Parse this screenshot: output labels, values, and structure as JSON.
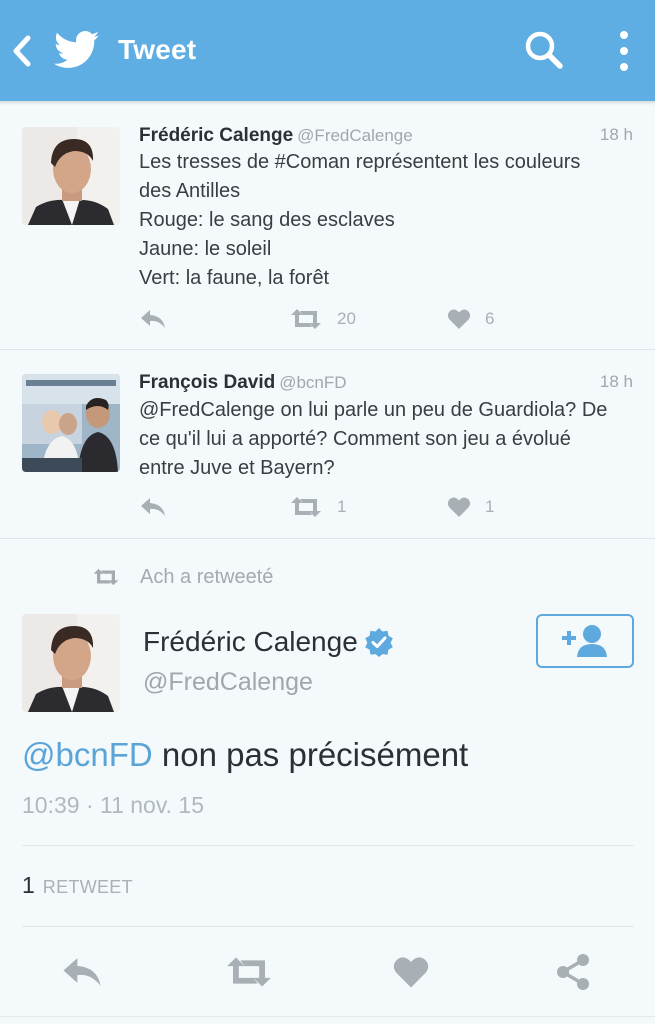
{
  "app_bar": {
    "title": "Tweet",
    "background": "#5eade3",
    "icons": [
      "back-arrow-icon",
      "twitter-bird-icon",
      "search-icon",
      "more-vertical-icon"
    ]
  },
  "timeline": [
    {
      "author": "Frédéric Calenge",
      "handle": "@FredCalenge",
      "time": "18 h",
      "lines": [
        "Les tresses de #Coman représentent les couleurs",
        "des Antilles",
        "Rouge: le sang des esclaves",
        "Jaune: le soleil",
        "Vert: la faune, la forêt"
      ],
      "retweets": "20",
      "likes": "6"
    },
    {
      "author": "François David",
      "handle": "@bcnFD",
      "time": "18 h",
      "lines": [
        "@FredCalenge on lui parle un peu de Guardiola? De",
        "ce qu'il lui a apporté? Comment son jeu a évolué",
        "entre Juve et Bayern?"
      ],
      "retweets": "1",
      "likes": "1"
    }
  ],
  "retweeted_by": "Ach a retweeté",
  "focused_tweet": {
    "author": "Frédéric Calenge",
    "handle": "@FredCalenge",
    "verified": true,
    "mention": "@bcnFD",
    "text": " non pas précisément",
    "timestamp": "10:39 · 11 nov. 15",
    "retweet_count": "1",
    "retweet_label": "RETWEET"
  },
  "colors": {
    "accent": "#5ea9dd",
    "mention": "#5ba4d8",
    "icon_gray": "#a8afb5",
    "background": "#f4fafb"
  }
}
